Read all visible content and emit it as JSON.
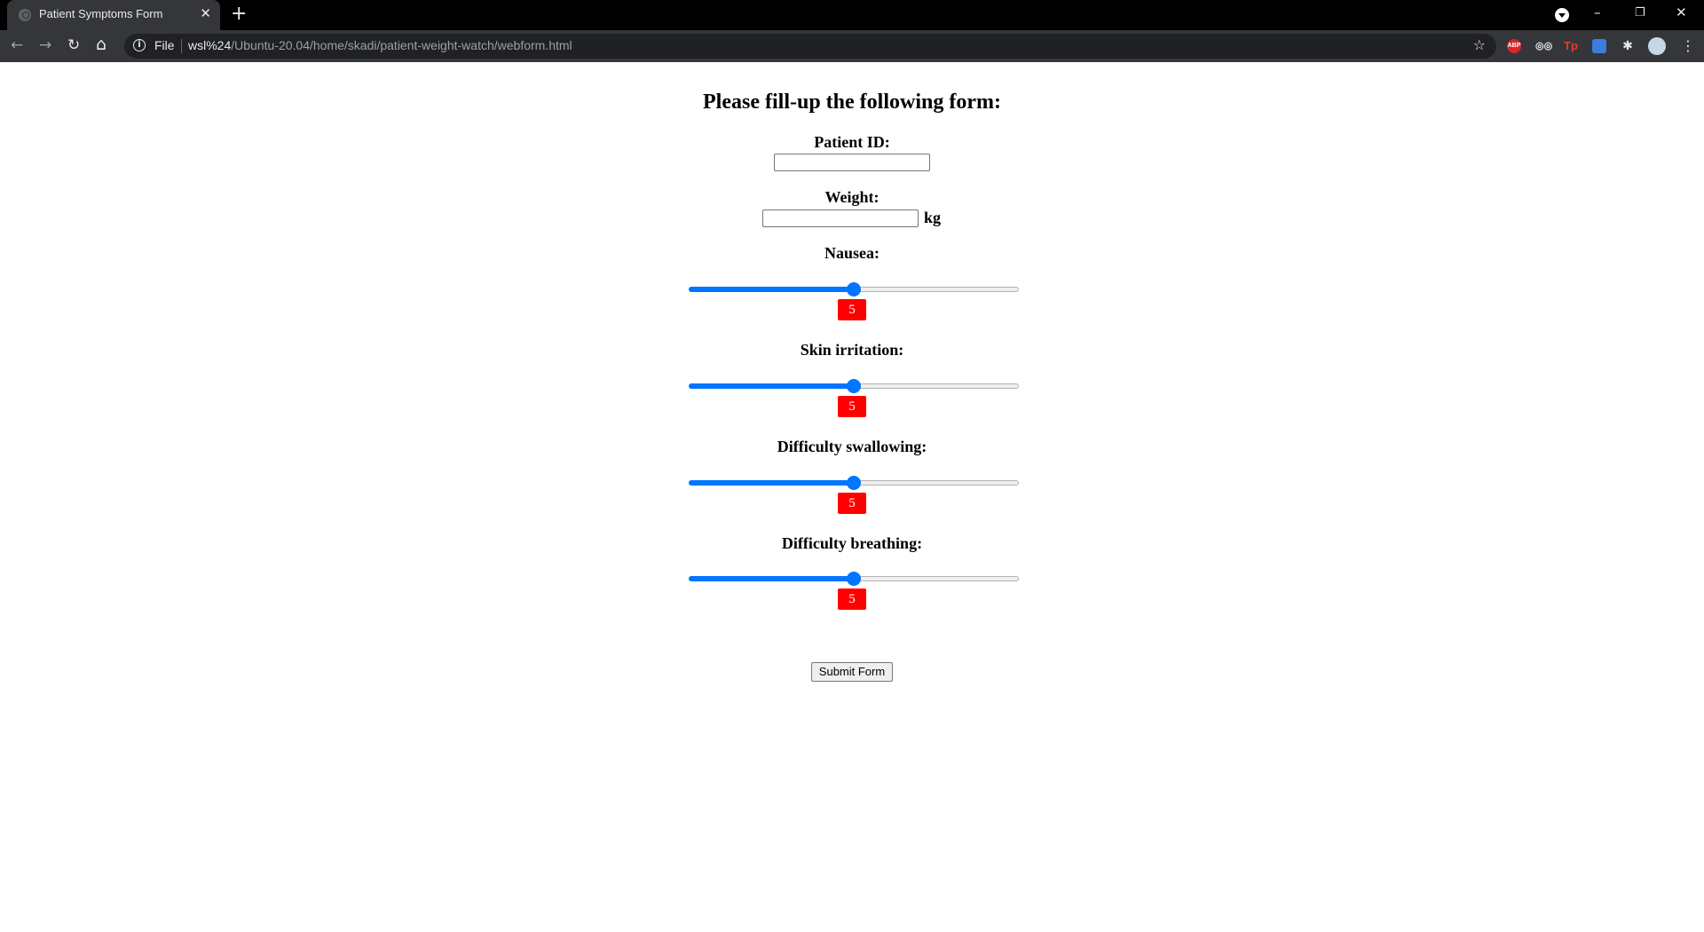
{
  "browser": {
    "tab_title": "Patient Symptoms Form",
    "tab_close": "✕",
    "new_tab": "+",
    "window_controls": {
      "minimize": "–",
      "restore": "❐",
      "close": "✕"
    },
    "nav": {
      "back": "←",
      "forward": "→",
      "reload": "↻",
      "home": "⌂"
    },
    "omnibox": {
      "info_icon": "i",
      "scheme_label": "File",
      "url_host": "wsl%24",
      "url_path": "/Ubuntu-20.04/home/skadi/patient-weight-watch/webform.html"
    },
    "bookmark_star": "☆",
    "extensions": [
      {
        "name": "adblock-plus-icon",
        "label": "ABP"
      },
      {
        "name": "spy-icon",
        "label": "◎◎"
      },
      {
        "name": "tp-icon",
        "label": "Tp"
      },
      {
        "name": "blue-extension-icon",
        "label": ""
      },
      {
        "name": "extensions-puzzle-icon",
        "label": "✱"
      }
    ],
    "menu": "⋮"
  },
  "form": {
    "heading": "Please fill-up the following form:",
    "patient_id": {
      "label": "Patient ID:",
      "value": ""
    },
    "weight": {
      "label": "Weight:",
      "value": "",
      "unit": "kg"
    },
    "sliders": [
      {
        "label": "Nausea:",
        "value": "5",
        "level": 0.5
      },
      {
        "label": "Skin irritation:",
        "value": "5",
        "level": 0.5
      },
      {
        "label": "Difficulty swallowing:",
        "value": "5",
        "level": 0.5
      },
      {
        "label": "Difficulty breathing:",
        "value": "5",
        "level": 0.5
      }
    ],
    "submit_label": "Submit Form"
  },
  "colors": {
    "accent": "#0075ff",
    "badge": "#ff0000",
    "chrome_dark": "#35363a"
  }
}
